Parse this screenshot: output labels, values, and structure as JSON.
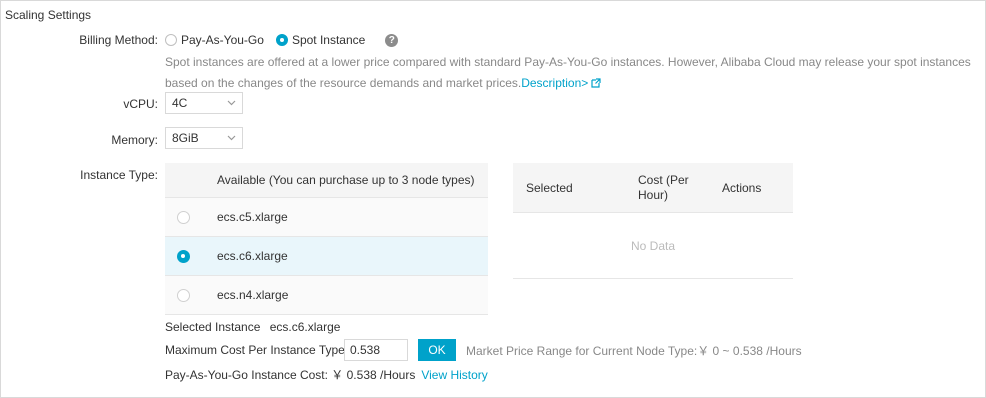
{
  "section_title": "Scaling Settings",
  "billing": {
    "label": "Billing Method:",
    "options": [
      "Pay-As-You-Go",
      "Spot Instance"
    ],
    "selected": "Spot Instance",
    "description": "Spot instances are offered at a lower price compared with standard Pay-As-You-Go instances. However, Alibaba Cloud may release your spot instances based on the changes of the resource demands and market prices.",
    "description_link": "Description>",
    "help_icon": "question-circle-icon"
  },
  "vcpu": {
    "label": "vCPU:",
    "value": "4C"
  },
  "memory": {
    "label": "Memory:",
    "value": "8GiB"
  },
  "instance_type": {
    "label": "Instance Type:",
    "available_header": "Available (You can purchase up to 3 node types)",
    "rows": [
      {
        "name": "ecs.c5.xlarge",
        "checked": false
      },
      {
        "name": "ecs.c6.xlarge",
        "checked": true
      },
      {
        "name": "ecs.n4.xlarge",
        "checked": false
      }
    ],
    "selected_headers": {
      "selected": "Selected",
      "cost": "Cost (Per Hour)",
      "actions": "Actions"
    },
    "empty_text": "No Data"
  },
  "selected_instance": {
    "label": "Selected Instance",
    "value": "ecs.c6.xlarge"
  },
  "max_cost": {
    "label": "Maximum Cost Per Instance Type:",
    "value": "0.538",
    "ok_label": "OK",
    "market_range": "Market Price Range for Current Node Type:￥ 0 ~ 0.538 /Hours"
  },
  "payg_cost": {
    "text": "Pay-As-You-Go Instance Cost: ￥ 0.538 /Hours",
    "link": "View History"
  },
  "colors": {
    "accent": "#00a2ca",
    "selected_row": "#e9f6fb",
    "muted_text": "#888888"
  }
}
